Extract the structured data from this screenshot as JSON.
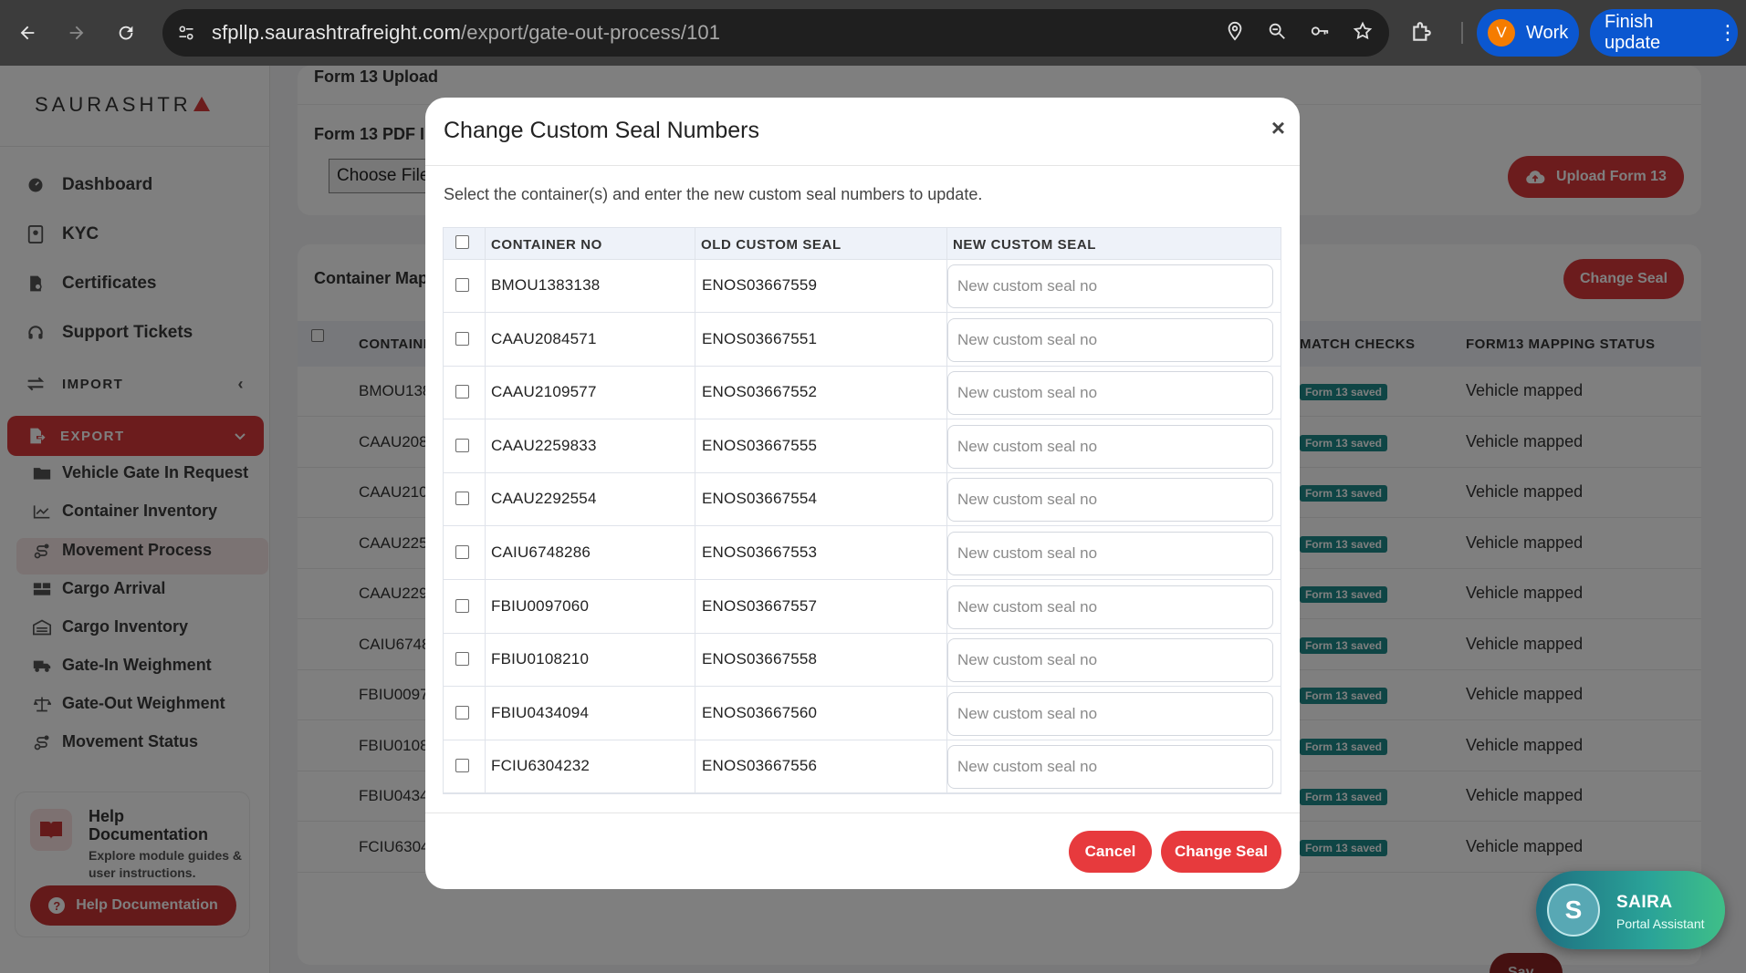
{
  "browser": {
    "url_host": "sfpllp.saurashtrafreight.com",
    "url_path": "/export/gate-out-process/101",
    "profile_initial": "V",
    "profile_label": "Work",
    "update_label": "Finish update"
  },
  "sidebar": {
    "logo": "SAURASHTR",
    "items": [
      {
        "label": "Dashboard",
        "icon": "dashboard-icon"
      },
      {
        "label": "KYC",
        "icon": "id-card-icon"
      },
      {
        "label": "Certificates",
        "icon": "certificate-icon"
      },
      {
        "label": "Support Tickets",
        "icon": "headset-icon"
      }
    ],
    "import_label": "IMPORT",
    "export_label": "EXPORT",
    "export_items": [
      {
        "label": "Vehicle Gate In Request",
        "icon": "folder-icon"
      },
      {
        "label": "Container Inventory",
        "icon": "chart-line-icon"
      },
      {
        "label": "Movement Process",
        "icon": "route-icon"
      },
      {
        "label": "Cargo Arrival",
        "icon": "boxes-icon"
      },
      {
        "label": "Cargo Inventory",
        "icon": "warehouse-icon"
      },
      {
        "label": "Gate-In Weighment",
        "icon": "truck-icon"
      },
      {
        "label": "Gate-Out Weighment",
        "icon": "scale-icon"
      },
      {
        "label": "Movement Status",
        "icon": "route-icon"
      }
    ],
    "help": {
      "title": "Help Documentation",
      "desc": "Explore module guides & user instructions.",
      "button": "Help Documentation"
    }
  },
  "background": {
    "form13_title": "Form 13 Upload",
    "form13_pdf_label": "Form 13 PDF I",
    "choose_file": "Choose File",
    "upload_button": "Upload Form 13",
    "container_map_title": "Container Map",
    "change_seal_button": "Change Seal",
    "columns": {
      "container": "CONTAINI",
      "match": "MATCH CHECKS",
      "mapping": "FORM13 MAPPING STATUS"
    },
    "rows": [
      {
        "container": "BMOU138",
        "badge": "Form 13 saved",
        "status": "Vehicle mapped"
      },
      {
        "container": "CAAU208",
        "badge": "Form 13 saved",
        "status": "Vehicle mapped"
      },
      {
        "container": "CAAU210",
        "badge": "Form 13 saved",
        "status": "Vehicle mapped"
      },
      {
        "container": "CAAU225",
        "badge": "Form 13 saved",
        "status": "Vehicle mapped"
      },
      {
        "container": "CAAU229",
        "badge": "Form 13 saved",
        "status": "Vehicle mapped"
      },
      {
        "container": "CAIU6748",
        "badge": "Form 13 saved",
        "status": "Vehicle mapped"
      },
      {
        "container": "FBIU0097",
        "badge": "Form 13 saved",
        "status": "Vehicle mapped"
      },
      {
        "container": "FBIU0108",
        "badge": "Form 13 saved",
        "status": "Vehicle mapped"
      },
      {
        "container": "FBIU0434",
        "badge": "Form 13 saved",
        "status": "Vehicle mapped"
      },
      {
        "container": "FCIU6304",
        "badge": "Form 13 saved",
        "status": "Vehicle mapped"
      }
    ],
    "save_button": "Sav"
  },
  "modal": {
    "title": "Change Custom Seal Numbers",
    "close": "×",
    "description": "Select the container(s) and enter the new custom seal numbers to update.",
    "columns": {
      "container": "CONTAINER NO",
      "old_seal": "OLD CUSTOM SEAL",
      "new_seal": "NEW CUSTOM SEAL"
    },
    "input_placeholder": "New custom seal no",
    "rows": [
      {
        "container": "BMOU1383138",
        "old_seal": "ENOS03667559",
        "new_seal": ""
      },
      {
        "container": "CAAU2084571",
        "old_seal": "ENOS03667551",
        "new_seal": ""
      },
      {
        "container": "CAAU2109577",
        "old_seal": "ENOS03667552",
        "new_seal": ""
      },
      {
        "container": "CAAU2259833",
        "old_seal": "ENOS03667555",
        "new_seal": ""
      },
      {
        "container": "CAAU2292554",
        "old_seal": "ENOS03667554",
        "new_seal": ""
      },
      {
        "container": "CAIU6748286",
        "old_seal": "ENOS03667553",
        "new_seal": ""
      },
      {
        "container": "FBIU0097060",
        "old_seal": "ENOS03667557",
        "new_seal": ""
      },
      {
        "container": "FBIU0108210",
        "old_seal": "ENOS03667558",
        "new_seal": ""
      },
      {
        "container": "FBIU0434094",
        "old_seal": "ENOS03667560",
        "new_seal": ""
      },
      {
        "container": "FCIU6304232",
        "old_seal": "ENOS03667556",
        "new_seal": ""
      }
    ],
    "cancel_button": "Cancel",
    "confirm_button": "Change Seal"
  },
  "assistant": {
    "initial": "S",
    "name": "SAIRA",
    "subtitle": "Portal Assistant"
  },
  "colors": {
    "brand_red": "#d8393a",
    "badge_teal": "#1e8a8a",
    "browser_blue": "#0b57d0"
  }
}
